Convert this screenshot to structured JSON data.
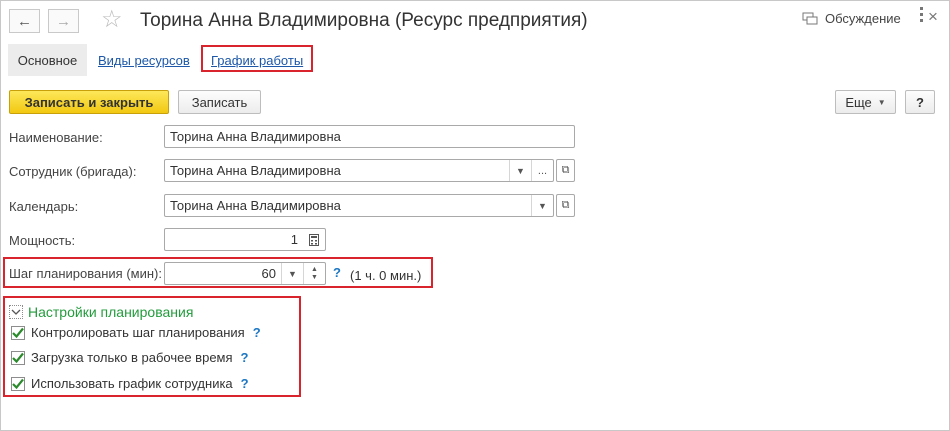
{
  "window": {
    "title": "Торина Анна Владимировна (Ресурс предприятия)",
    "discussion_label": "Обсуждение"
  },
  "tabs": [
    {
      "label": "Основное"
    },
    {
      "label": "Виды ресурсов"
    },
    {
      "label": "График работы"
    }
  ],
  "toolbar": {
    "save_close_label": "Записать и закрыть",
    "save_label": "Записать",
    "more_label": "Еще",
    "help_label": "?"
  },
  "form": {
    "name_label": "Наименование:",
    "name_value": "Торина Анна Владимировна",
    "employee_label": "Сотрудник (бригада):",
    "employee_value": "Торина Анна Владимировна",
    "calendar_label": "Календарь:",
    "calendar_value": "Торина Анна Владимировна",
    "capacity_label": "Мощность:",
    "capacity_value": "1",
    "step_label": "Шаг планирования (мин):",
    "step_value": "60",
    "step_help": "?",
    "step_hint": "(1 ч. 0 мин.)"
  },
  "planning": {
    "group_title": "Настройки планирования",
    "options": [
      {
        "label": "Контролировать шаг планирования",
        "checked": true,
        "help": "?"
      },
      {
        "label": "Загрузка только в рабочее время",
        "checked": true,
        "help": "?"
      },
      {
        "label": "Использовать график сотрудника",
        "checked": true,
        "help": "?"
      }
    ]
  }
}
